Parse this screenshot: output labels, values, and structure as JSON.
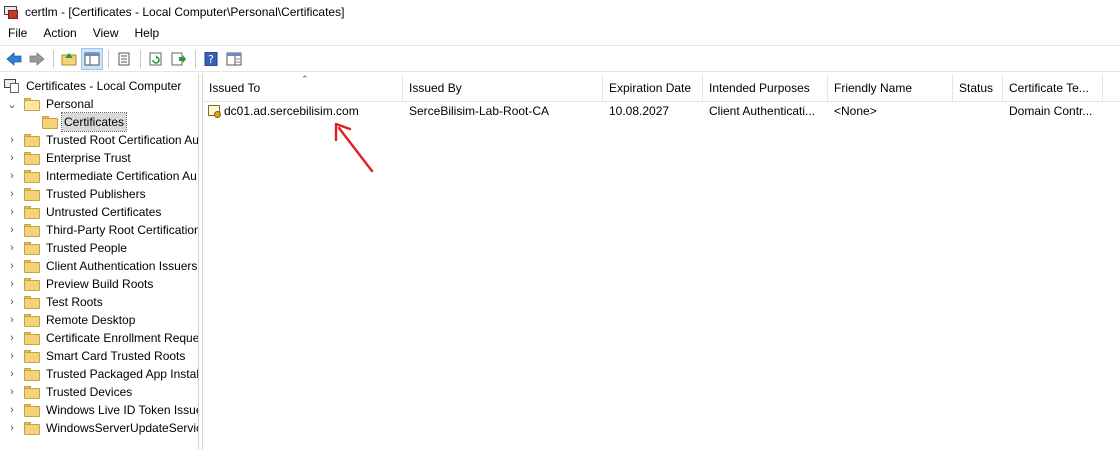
{
  "window": {
    "title": "certlm - [Certificates - Local Computer\\Personal\\Certificates]"
  },
  "menu": [
    "File",
    "Action",
    "View",
    "Help"
  ],
  "toolbar": {
    "buttons": [
      "back-icon",
      "forward-icon",
      "up-folder-icon",
      "show-hide-tree-icon",
      "properties-icon",
      "refresh-icon",
      "export-list-icon",
      "help-icon",
      "console-window-icon"
    ]
  },
  "tree": {
    "root": "Certificates - Local Computer",
    "personal": "Personal",
    "selected_child": "Certificates",
    "folders": [
      "Trusted Root Certification Au",
      "Enterprise Trust",
      "Intermediate Certification Au",
      "Trusted Publishers",
      "Untrusted Certificates",
      "Third-Party Root Certification",
      "Trusted People",
      "Client Authentication Issuers",
      "Preview Build Roots",
      "Test Roots",
      "Remote Desktop",
      "Certificate Enrollment Reque",
      "Smart Card Trusted Roots",
      "Trusted Packaged App Install",
      "Trusted Devices",
      "Windows Live ID Token Issuer",
      "WindowsServerUpdateService"
    ]
  },
  "list": {
    "columns": [
      "Issued To",
      "Issued By",
      "Expiration Date",
      "Intended Purposes",
      "Friendly Name",
      "Status",
      "Certificate Te..."
    ],
    "rows": [
      {
        "issued_to": "dc01.ad.sercebilisim.com",
        "issued_by": "SerceBilisim-Lab-Root-CA",
        "expiration": "10.08.2027",
        "purposes": "Client Authenticati...",
        "friendly_name": "<None>",
        "status": "",
        "template": "Domain Contr..."
      }
    ]
  },
  "colors": {
    "selection": "#d9d9d9",
    "folder": "#f4d37a",
    "annotation_arrow": "#e02020"
  }
}
